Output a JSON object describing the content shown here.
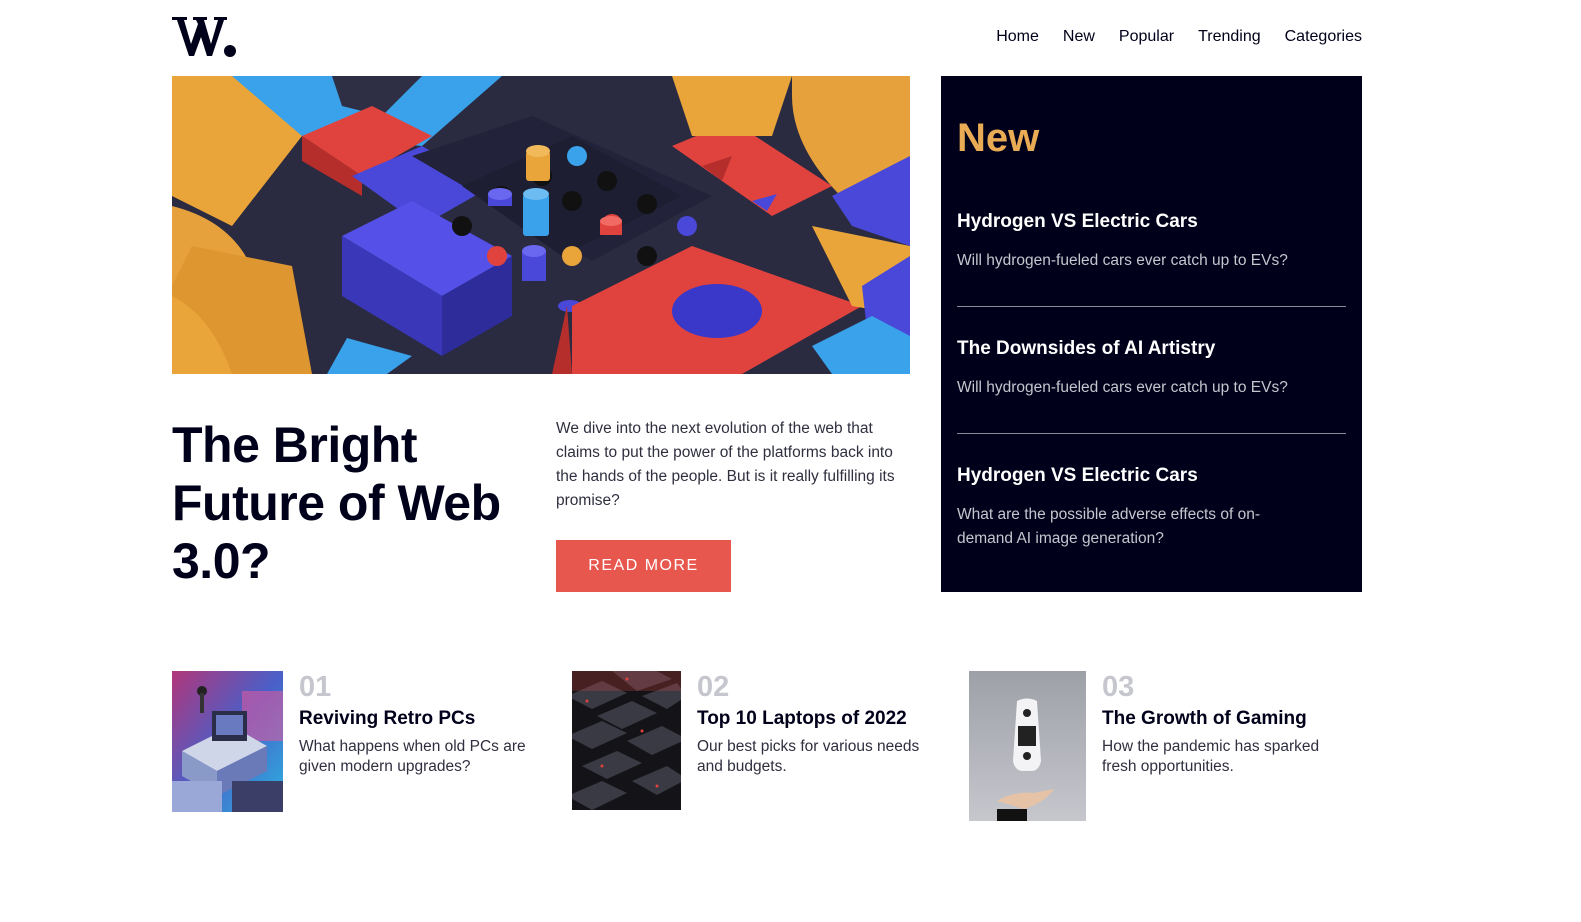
{
  "header": {
    "logo_text": "W.",
    "nav": [
      "Home",
      "New",
      "Popular",
      "Trending",
      "Categories"
    ]
  },
  "hero": {
    "title": "The Bright Future of Web 3.0?",
    "description": "We dive into the next evolution of the web that claims to put the power of the platforms back into the hands of the people. But is it really fulfilling its promise?",
    "button_label": "READ MORE"
  },
  "new_panel": {
    "heading": "New",
    "items": [
      {
        "title": "Hydrogen VS Electric Cars",
        "description": "Will hydrogen-fueled cars ever catch up to EVs?"
      },
      {
        "title": "The Downsides of AI Artistry",
        "description": "Will hydrogen-fueled cars ever catch up to EVs?"
      },
      {
        "title": "Hydrogen VS Electric Cars",
        "description": "What are the possible adverse effects of on-demand AI image generation?"
      }
    ]
  },
  "cards": [
    {
      "number": "01",
      "title": "Reviving Retro PCs",
      "description": "What happens when old PCs are given modern upgrades?"
    },
    {
      "number": "02",
      "title": "Top 10 Laptops of 2022",
      "description": "Our best picks for various needs and budgets."
    },
    {
      "number": "03",
      "title": "The Growth of Gaming",
      "description": "How the pandemic has sparked fresh opportunities."
    }
  ],
  "colors": {
    "accent": "#e8574e",
    "gold": "#e9ab53",
    "dark": "#00001a",
    "muted": "#c5c6ce"
  }
}
